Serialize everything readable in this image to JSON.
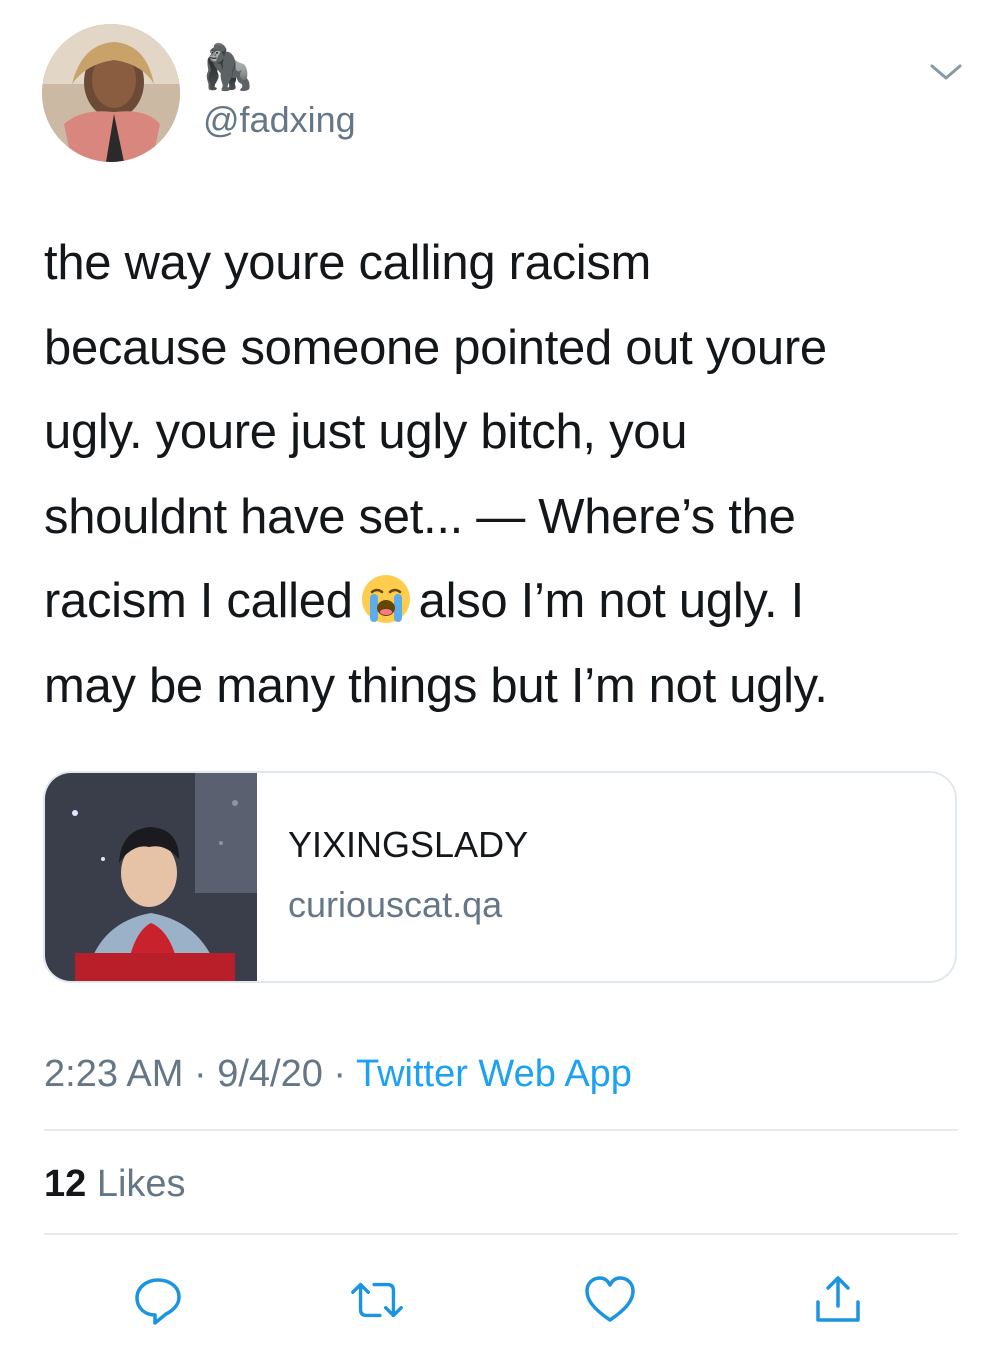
{
  "author": {
    "display_name": "🦍",
    "handle": "@fadxing"
  },
  "tweet": {
    "lines": [
      "the way youre calling racism",
      "because someone pointed out youre",
      "ugly. youre just ugly bitch, you",
      "shouldnt have set... — Where’s the",
      "racism I called",
      "also I’m not ugly. I",
      "may be many things but I’m not ugly."
    ],
    "emoji": "loudly-crying-face-emoji"
  },
  "card": {
    "title": "YIXINGSLADY",
    "domain": "curiouscat.qa"
  },
  "meta": {
    "time": "2:23 AM",
    "separator": "·",
    "date": "9/4/20",
    "source": "Twitter Web App"
  },
  "stats": {
    "likes_count": "12",
    "likes_label": "Likes"
  },
  "actions": [
    "reply-icon",
    "retweet-icon",
    "like-icon",
    "share-icon"
  ],
  "colors": {
    "link": "#1da1f2",
    "secondary_text": "#657786",
    "primary_text": "#14171a",
    "divider": "#e6ecf0"
  }
}
